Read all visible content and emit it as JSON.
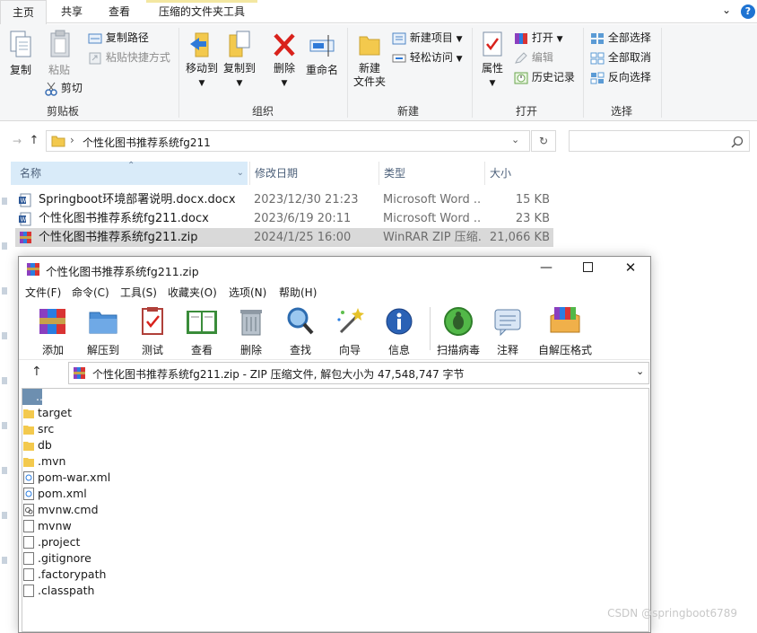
{
  "ribbon_tabs": {
    "home": "主页",
    "share": "共享",
    "view": "查看",
    "tools": "压缩的文件夹工具"
  },
  "clipboard": {
    "copy": "复制",
    "paste": "粘贴",
    "copy_path": "复制路径",
    "paste_shortcut": "粘贴快捷方式",
    "cut": "剪切",
    "group": "剪贴板"
  },
  "organize": {
    "move_to": "移动到",
    "copy_to": "复制到",
    "delete": "删除",
    "rename": "重命名",
    "group": "组织"
  },
  "new": {
    "new_folder": "新建\n文件夹",
    "new_item": "新建项目",
    "easy_access": "轻松访问",
    "group": "新建"
  },
  "open": {
    "properties": "属性",
    "open": "打开",
    "edit": "编辑",
    "history": "历史记录",
    "group": "打开"
  },
  "select": {
    "select_all": "全部选择",
    "select_none": "全部取消",
    "invert": "反向选择",
    "group": "选择"
  },
  "address": {
    "path": "个性化图书推荐系统fg211"
  },
  "columns": {
    "name": "名称",
    "date": "修改日期",
    "type": "类型",
    "size": "大小"
  },
  "files": [
    {
      "name": "Springboot环境部署说明.docx.docx",
      "date": "2023/12/30 21:23",
      "type": "Microsoft Word ...",
      "size": "15 KB",
      "icon": "word-icon"
    },
    {
      "name": "个性化图书推荐系统fg211.docx",
      "date": "2023/6/19 20:11",
      "type": "Microsoft Word ...",
      "size": "23 KB",
      "icon": "word-icon"
    },
    {
      "name": "个性化图书推荐系统fg211.zip",
      "date": "2024/1/25 16:00",
      "type": "WinRAR ZIP 压缩...",
      "size": "21,066 KB",
      "icon": "winrar-icon"
    }
  ],
  "rar": {
    "title": "个性化图书推荐系统fg211.zip",
    "menu": [
      "文件(F)",
      "命令(C)",
      "工具(S)",
      "收藏夹(O)",
      "选项(N)",
      "帮助(H)"
    ],
    "toolbar": [
      "添加",
      "解压到",
      "测试",
      "查看",
      "删除",
      "查找",
      "向导",
      "信息",
      "扫描病毒",
      "注释",
      "自解压格式"
    ],
    "path": "个性化图书推荐系统fg211.zip - ZIP 压缩文件, 解包大小为 47,548,747 字节",
    "items": [
      {
        "name": "..",
        "icon": "parent-folder-icon"
      },
      {
        "name": "target",
        "icon": "folder-icon"
      },
      {
        "name": "src",
        "icon": "folder-icon"
      },
      {
        "name": "db",
        "icon": "folder-icon"
      },
      {
        "name": ".mvn",
        "icon": "folder-icon"
      },
      {
        "name": "pom-war.xml",
        "icon": "xml-file-icon"
      },
      {
        "name": "pom.xml",
        "icon": "xml-file-icon"
      },
      {
        "name": "mvnw.cmd",
        "icon": "cmd-file-icon"
      },
      {
        "name": "mvnw",
        "icon": "file-icon"
      },
      {
        "name": ".project",
        "icon": "file-icon"
      },
      {
        "name": ".gitignore",
        "icon": "file-icon"
      },
      {
        "name": ".factorypath",
        "icon": "file-icon"
      },
      {
        "name": ".classpath",
        "icon": "file-icon"
      }
    ]
  },
  "watermark": "CSDN @springboot6789"
}
